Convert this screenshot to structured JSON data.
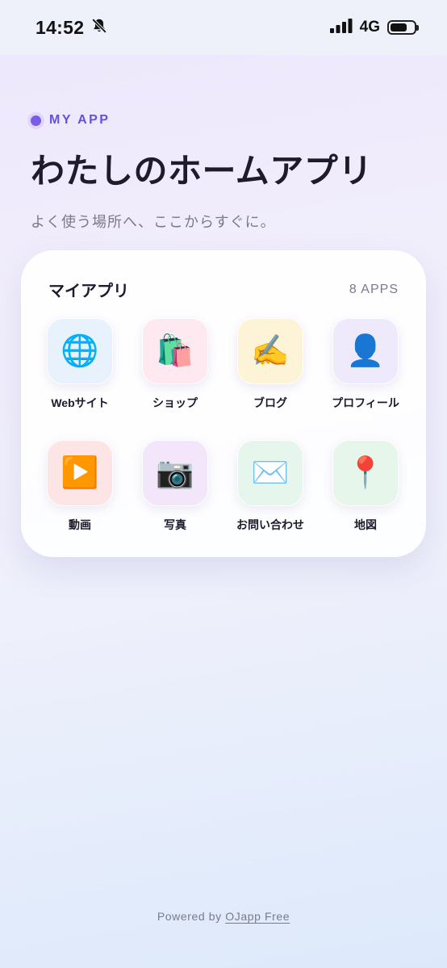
{
  "status_bar": {
    "time": "14:52",
    "network": "4G",
    "battery_level": 0.7
  },
  "hero": {
    "eyebrow": "MY APP",
    "title": "わたしのホームアプリ",
    "subtitle": "よく使う場所へ、ここからすぐに。",
    "accent_color": "#6a4fd9"
  },
  "card": {
    "title": "マイアプリ",
    "count": "8 APPS",
    "apps": [
      {
        "label": "Webサイト",
        "glyph": "🌐",
        "icon_name": "globe-icon",
        "bg": "#e8f2fd"
      },
      {
        "label": "ショップ",
        "glyph": "🛍️",
        "icon_name": "shopping-bags-icon",
        "bg": "#fde9ef"
      },
      {
        "label": "ブログ",
        "glyph": "✍️",
        "icon_name": "writing-hand-icon",
        "bg": "#fdf3d6"
      },
      {
        "label": "プロフィール",
        "glyph": "👤",
        "icon_name": "person-silhouette-icon",
        "bg": "#efeafb"
      },
      {
        "label": "動画",
        "glyph": "▶️",
        "icon_name": "play-button-icon",
        "bg": "#fde5e5"
      },
      {
        "label": "写真",
        "glyph": "📷",
        "icon_name": "camera-icon",
        "bg": "#f3e6fb"
      },
      {
        "label": "お問い合わせ",
        "glyph": "✉️",
        "icon_name": "envelope-icon",
        "bg": "#e6f6ec"
      },
      {
        "label": "地図",
        "glyph": "📍",
        "icon_name": "map-pin-icon",
        "bg": "#e6f6ea"
      }
    ]
  },
  "footer": {
    "prefix": "Powered by",
    "link": "OJapp Free"
  }
}
